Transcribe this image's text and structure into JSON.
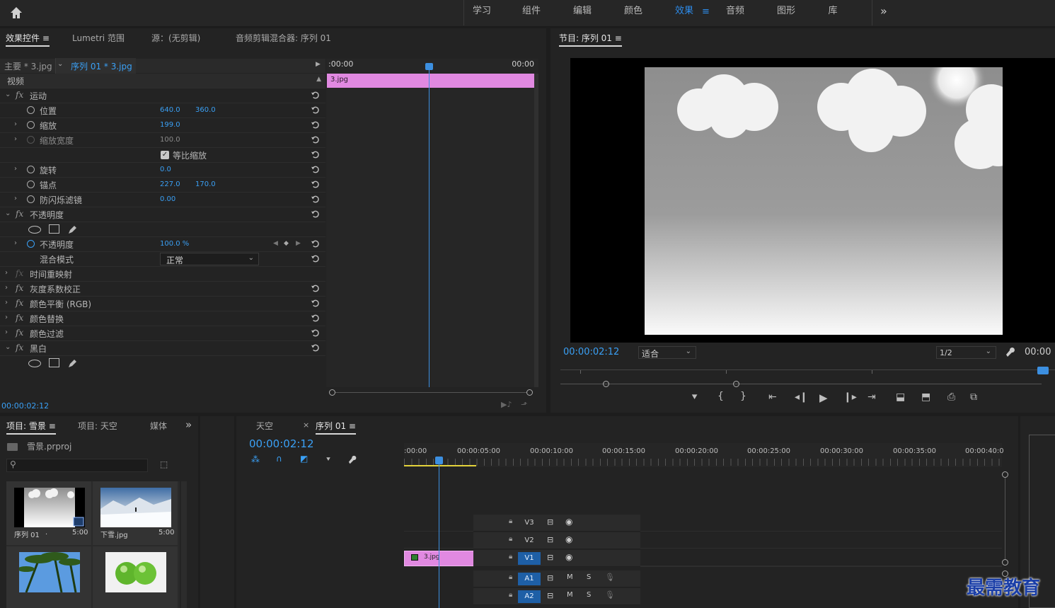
{
  "workspaces": [
    "学习",
    "组件",
    "编辑",
    "颜色",
    "效果",
    "音频",
    "图形",
    "库"
  ],
  "active_workspace": "效果",
  "ec_tabs": {
    "effect_controls": "效果控件",
    "lumetri": "Lumetri 范围",
    "source": "源：(无剪辑)",
    "audio_mixer": "音频剪辑混合器: 序列 01"
  },
  "ec": {
    "master": "主要 * 3.jpg",
    "sequence": "序列 01 * 3.jpg",
    "time_start": ":00:00",
    "time_end": "00:00",
    "clip_name": "3.jpg",
    "video_header": "视频",
    "motion": "运动",
    "position": "位置",
    "pos_x": "640.0",
    "pos_y": "360.0",
    "scale": "缩放",
    "scale_v": "199.0",
    "scale_width": "缩放宽度",
    "scale_width_v": "100.0",
    "uniform": "等比缩放",
    "rotation": "旋转",
    "rotation_v": "0.0",
    "anchor": "锚点",
    "anchor_x": "227.0",
    "anchor_y": "170.0",
    "flicker": "防闪烁滤镜",
    "flicker_v": "0.00",
    "opacity_section": "不透明度",
    "opacity": "不透明度",
    "opacity_v": "100.0 %",
    "blend": "混合模式",
    "blend_v": "正常",
    "time_remap": "时间重映射",
    "gamma": "灰度系数校正",
    "color_balance": "颜色平衡 (RGB)",
    "color_replace": "颜色替换",
    "color_pass": "颜色过滤",
    "bw": "黑白",
    "current_time": "00:00:02:12"
  },
  "program": {
    "title": "节目: 序列 01",
    "timecode": "00:00:02:12",
    "fit": "适合",
    "resolution": "1/2",
    "timecode_right": "00:00"
  },
  "project": {
    "tab_project": "项目: 雪景",
    "tab_project2": "项目: 天空",
    "tab_media": "媒体",
    "file": "雪景.prproj",
    "items": [
      {
        "name": "序列 01",
        "extra": ".",
        "dur": "5:00"
      },
      {
        "name": "下雪.jpg",
        "dur": "5:00"
      },
      {
        "name": "",
        "dur": ""
      },
      {
        "name": "",
        "dur": ""
      }
    ]
  },
  "timeline": {
    "tab_sky": "天空",
    "tab_seq": "序列 01",
    "timecode": "00:00:02:12",
    "ruler": [
      ":00:00",
      "00:00:05:00",
      "00:00:10:00",
      "00:00:15:00",
      "00:00:20:00",
      "00:00:25:00",
      "00:00:30:00",
      "00:00:35:00",
      "00:00:40:0"
    ],
    "tracks": [
      "V3",
      "V2",
      "V1",
      "A1",
      "A2"
    ],
    "clip": "3.jpg",
    "m": "M",
    "s": "S"
  },
  "watermark": "最需教育",
  "colors": {
    "accent": "#2d8ceb",
    "clip": "#e189e1",
    "seq_track": "#1e5fa6"
  }
}
